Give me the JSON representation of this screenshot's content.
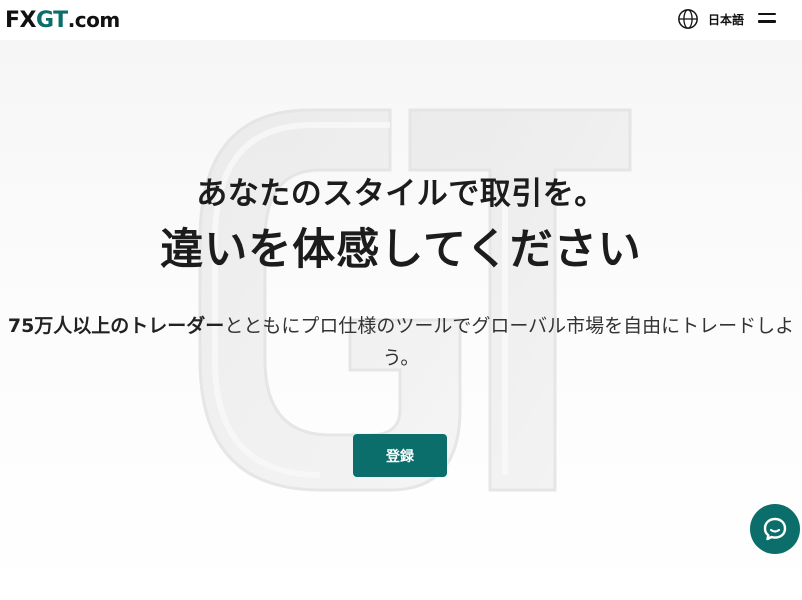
{
  "header": {
    "logo": {
      "part_fx": "FX",
      "part_gt": "GT",
      "part_domain": ".com"
    },
    "language": {
      "label": "日本語",
      "icon": "globe-icon"
    },
    "menu": {
      "icon": "hamburger-menu-icon"
    }
  },
  "hero": {
    "headline_line1": "あなたのスタイルで取引を。",
    "headline_line2": "違いを体感してください",
    "subtext_strong": "75万人以上のトレーダー",
    "subtext_rest": "とともにプロ仕様のツールでグローバル市場を自由にトレードしよう。",
    "register_label": "登録",
    "watermark_icon": "gt-logo-watermark"
  },
  "chat": {
    "icon": "chat-bubble-icon"
  },
  "colors": {
    "brand": "#0b6e6a",
    "text": "#1c1c1c",
    "background": "#ffffff"
  }
}
